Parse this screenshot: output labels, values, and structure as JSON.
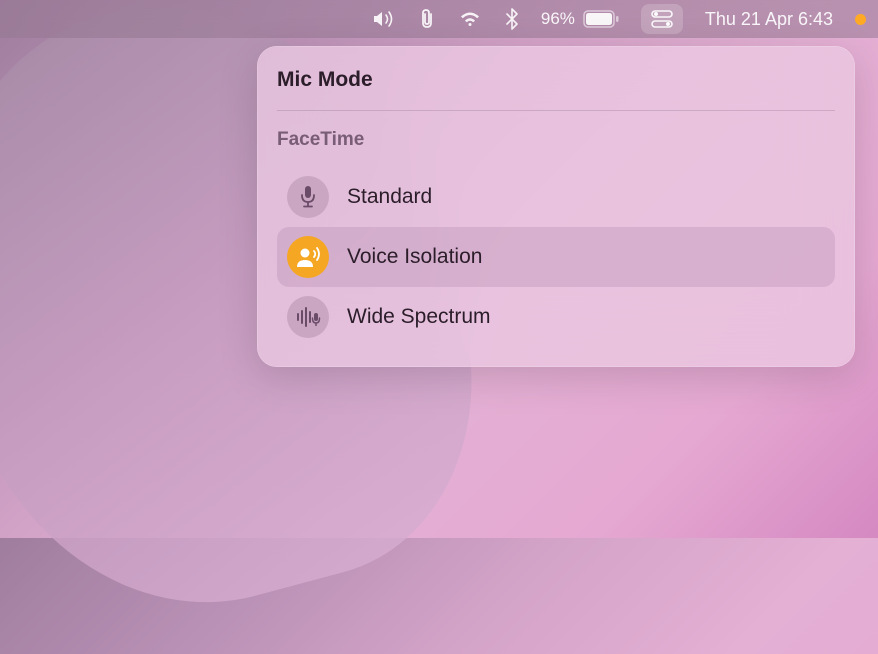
{
  "menubar": {
    "battery_percent": "96%",
    "datetime": "Thu 21 Apr  6:43"
  },
  "popover": {
    "title": "Mic Mode",
    "section_label": "FaceTime",
    "options": [
      {
        "label": "Standard"
      },
      {
        "label": "Voice Isolation"
      },
      {
        "label": "Wide Spectrum"
      }
    ]
  }
}
